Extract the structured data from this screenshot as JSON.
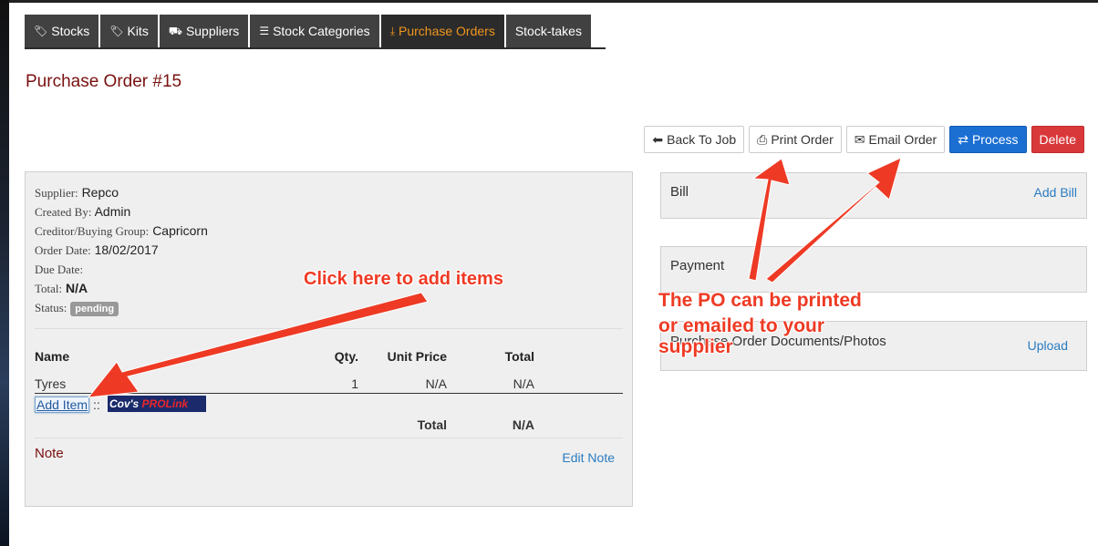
{
  "tabs": [
    {
      "label": "Stocks",
      "icon": "tags-icon"
    },
    {
      "label": "Kits",
      "icon": "tags-icon"
    },
    {
      "label": "Suppliers",
      "icon": "truck-icon"
    },
    {
      "label": "Stock Categories",
      "icon": "list-icon"
    },
    {
      "label": "Purchase Orders",
      "icon": "download-icon",
      "active": true
    },
    {
      "label": "Stock-takes",
      "icon": ""
    }
  ],
  "page": {
    "title": "Purchase Order #15"
  },
  "actions": {
    "back": "Back To Job",
    "print": "Print Order",
    "email": "Email Order",
    "process": "Process",
    "delete": "Delete"
  },
  "order": {
    "supplier_label": "Supplier:",
    "supplier": "Repco",
    "created_by_label": "Created By:",
    "created_by": "Admin",
    "creditor_label": "Creditor/Buying Group:",
    "creditor": "Capricorn",
    "order_date_label": "Order Date:",
    "order_date": "18/02/2017",
    "due_date_label": "Due Date:",
    "due_date": "",
    "total_label": "Total:",
    "total": "N/A",
    "status_label": "Status:",
    "status": "pending"
  },
  "items": {
    "headers": {
      "name": "Name",
      "qty": "Qty.",
      "unit_price": "Unit Price",
      "total": "Total"
    },
    "rows": [
      {
        "name": "Tyres",
        "qty": "1",
        "unit_price": "N/A",
        "total": "N/A"
      }
    ],
    "add_item": "Add Item",
    "separator": "::",
    "prolink_a": "Cov's ",
    "prolink_b": "PROLink",
    "footer_label": "Total",
    "footer_total": "N/A"
  },
  "note": {
    "label": "Note",
    "edit": "Edit Note"
  },
  "bill": {
    "title": "Bill",
    "action": "Add Bill"
  },
  "payment": {
    "title": "Payment"
  },
  "documents": {
    "title": "Purchase Order Documents/Photos",
    "action": "Upload"
  },
  "annotations": {
    "add_items": "Click here to add items",
    "po_line1": "The PO can be printed",
    "po_line2": "or emailed to your",
    "po_line3": "supplier"
  },
  "colors": {
    "accent_tab": "#f0961e",
    "title": "#7a1010",
    "primary": "#1b6fd3",
    "danger": "#d9383a",
    "annotation": "#ee3a24",
    "link": "#2b7bc0"
  }
}
